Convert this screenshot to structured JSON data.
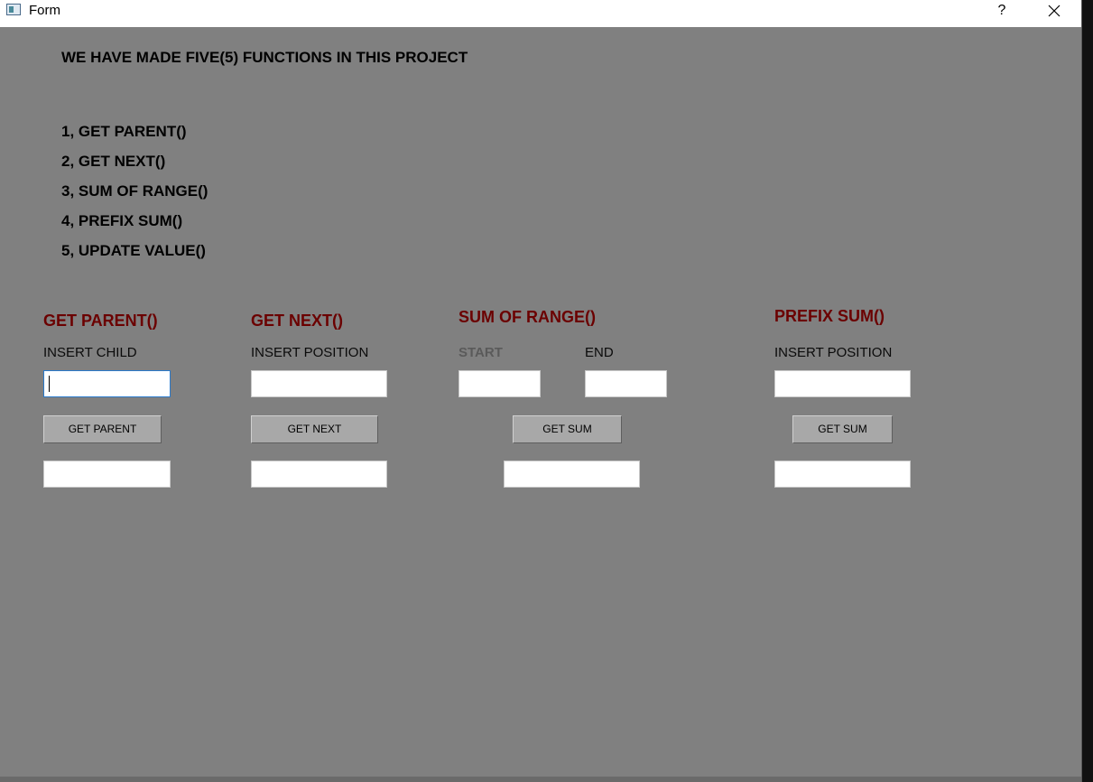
{
  "window": {
    "title": "Form",
    "help_label": "?"
  },
  "intro": {
    "heading": "WE HAVE MADE FIVE(5) FUNCTIONS IN THIS PROJECT",
    "functions": [
      "1, GET PARENT()",
      "2, GET NEXT()",
      "3, SUM OF RANGE()",
      "4, PREFIX SUM()",
      "5, UPDATE VALUE()"
    ]
  },
  "get_parent": {
    "title": "GET PARENT()",
    "input_label": "INSERT CHILD",
    "input_value": "",
    "button_label": "GET PARENT",
    "output_value": ""
  },
  "get_next": {
    "title": "GET NEXT()",
    "input_label": "INSERT POSITION",
    "input_value": "",
    "button_label": "GET NEXT",
    "output_value": ""
  },
  "sum_of_range": {
    "title": "SUM OF RANGE()",
    "start_label": "START",
    "end_label": "END",
    "start_value": "",
    "end_value": "",
    "button_label": "GET SUM",
    "output_value": ""
  },
  "prefix_sum": {
    "title": "PREFIX SUM()",
    "input_label": "INSERT POSITION",
    "input_value": "",
    "button_label": "GET SUM",
    "output_value": ""
  },
  "colors": {
    "background": "#808080",
    "section_title": "#6b0000",
    "focus_border": "#2a7acb"
  }
}
